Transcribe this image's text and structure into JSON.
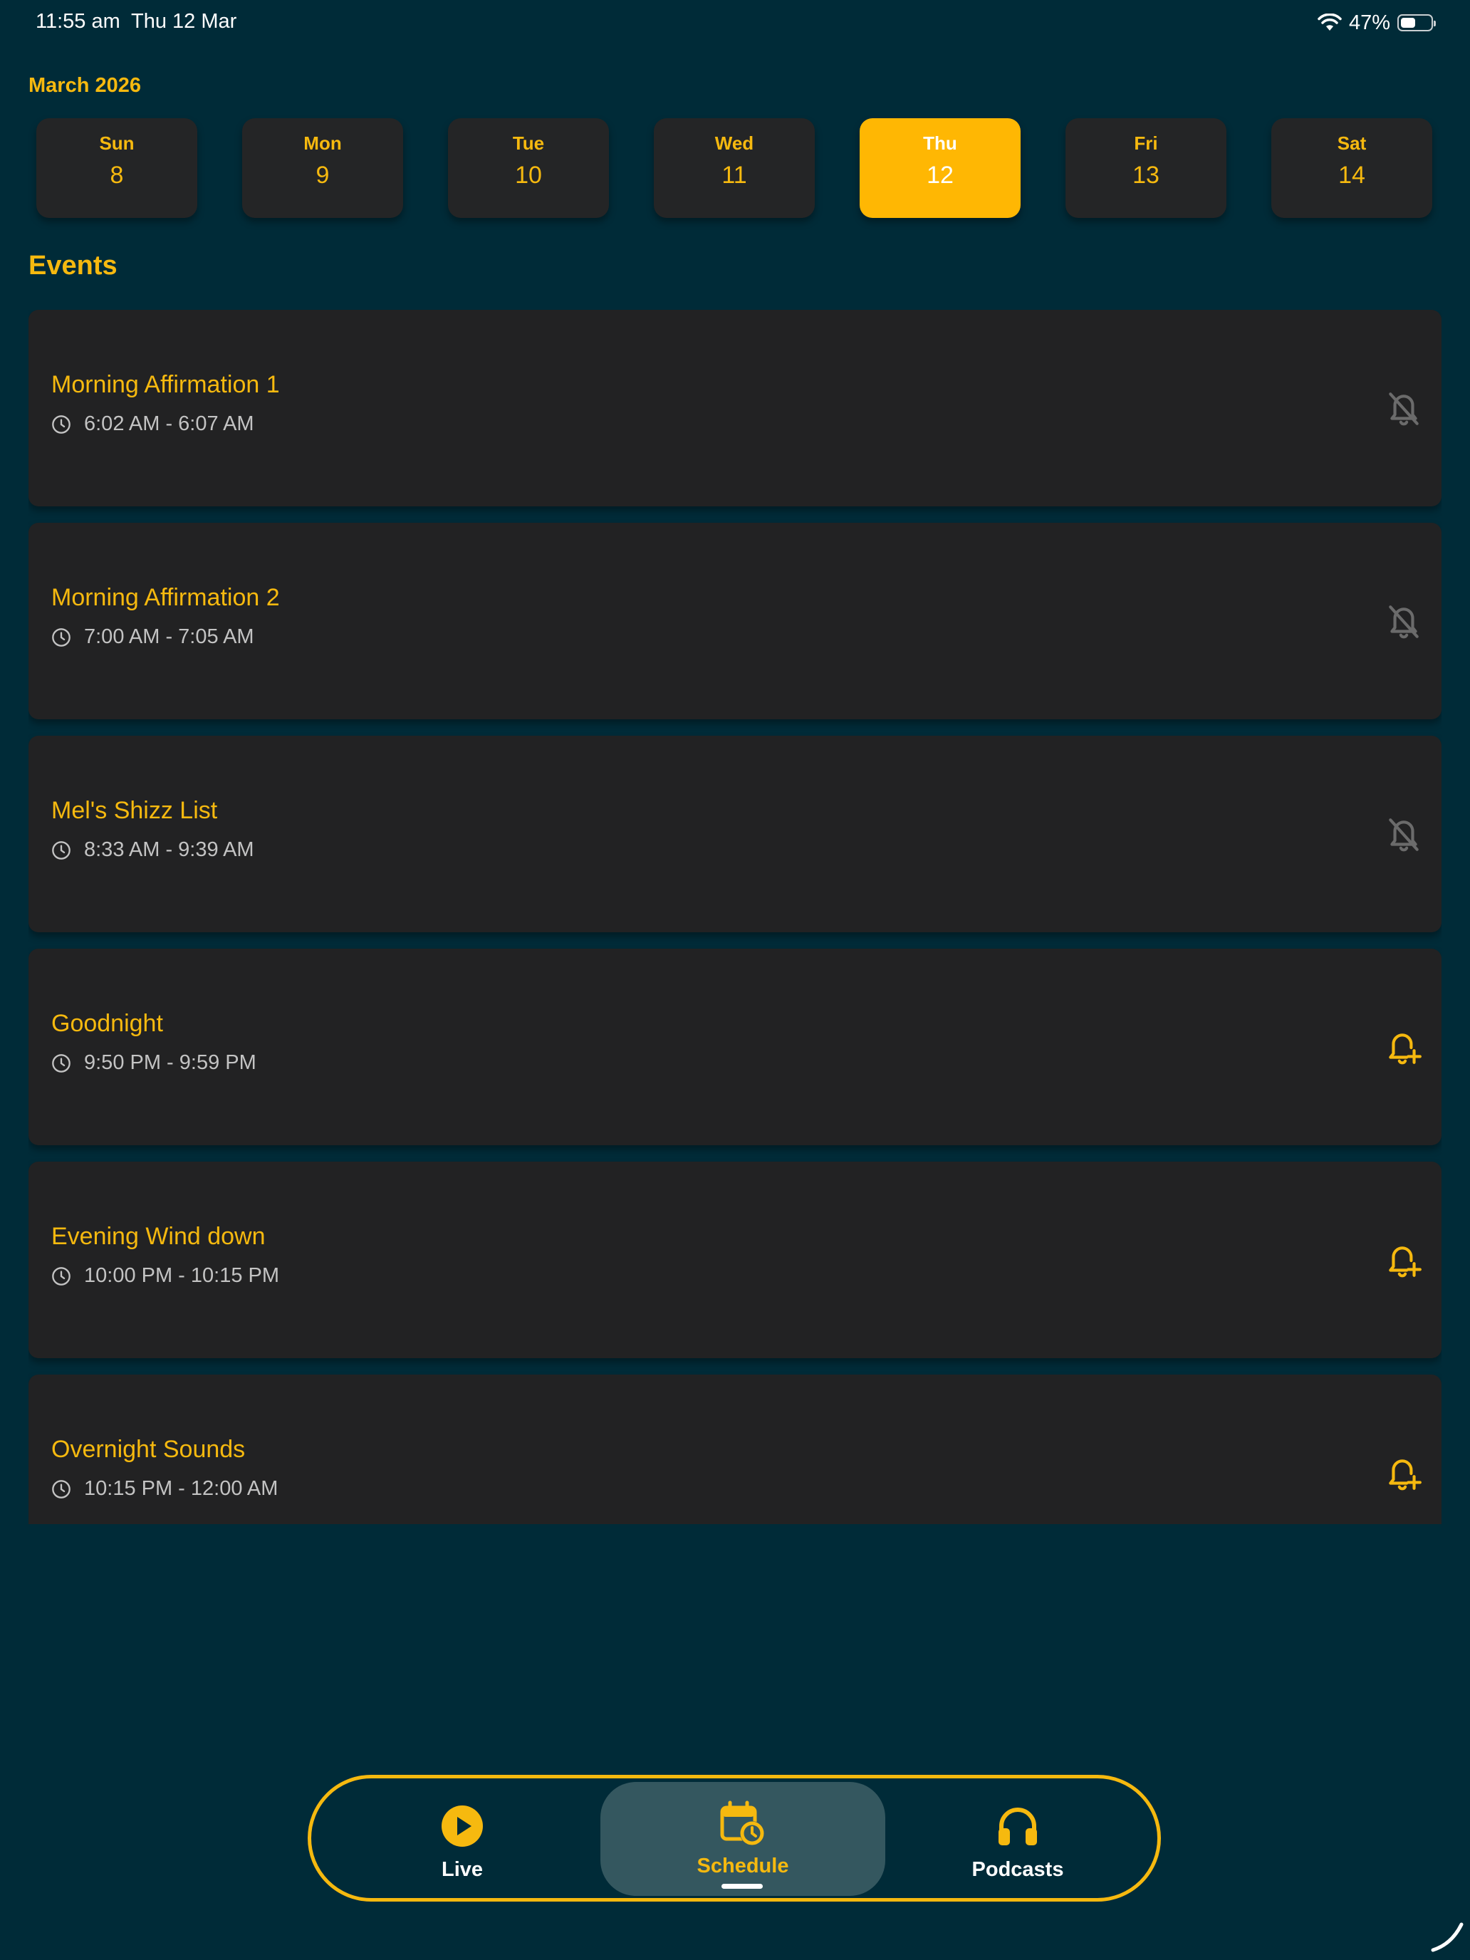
{
  "status_bar": {
    "time": "11:55 am",
    "date": "Thu 12 Mar",
    "battery_percent": "47%",
    "battery_level": 0.47
  },
  "calendar": {
    "month": "March 2026",
    "days": [
      {
        "name": "Sun",
        "number": "8",
        "selected": false
      },
      {
        "name": "Mon",
        "number": "9",
        "selected": false
      },
      {
        "name": "Tue",
        "number": "10",
        "selected": false
      },
      {
        "name": "Wed",
        "number": "11",
        "selected": false
      },
      {
        "name": "Thu",
        "number": "12",
        "selected": true
      },
      {
        "name": "Fri",
        "number": "13",
        "selected": false
      },
      {
        "name": "Sat",
        "number": "14",
        "selected": false
      }
    ]
  },
  "events": {
    "title": "Events",
    "items": [
      {
        "name": "Morning Affirmation 1",
        "time": "6:02 AM - 6:07 AM",
        "bell": "bell-off-icon"
      },
      {
        "name": "Morning Affirmation 2",
        "time": "7:00 AM - 7:05 AM",
        "bell": "bell-off-icon"
      },
      {
        "name": "Mel's Shizz List",
        "time": "8:33 AM - 9:39 AM",
        "bell": "bell-off-icon"
      },
      {
        "name": "Goodnight",
        "time": "9:50 PM - 9:59 PM",
        "bell": "bell-plus-icon"
      },
      {
        "name": "Evening Wind down",
        "time": "10:00 PM - 10:15 PM",
        "bell": "bell-plus-icon"
      },
      {
        "name": "Overnight Sounds",
        "time": "10:15 PM - 12:00 AM",
        "bell": "bell-plus-icon"
      }
    ]
  },
  "nav": {
    "live_label": "Live",
    "schedule_label": "Schedule",
    "podcasts_label": "Podcasts",
    "active": "schedule"
  },
  "colors": {
    "background": "#002b38",
    "accent": "#f6b90f",
    "selected_day": "#ffb703",
    "card": "#222223",
    "inactive_icon": "#6b6b6b"
  }
}
